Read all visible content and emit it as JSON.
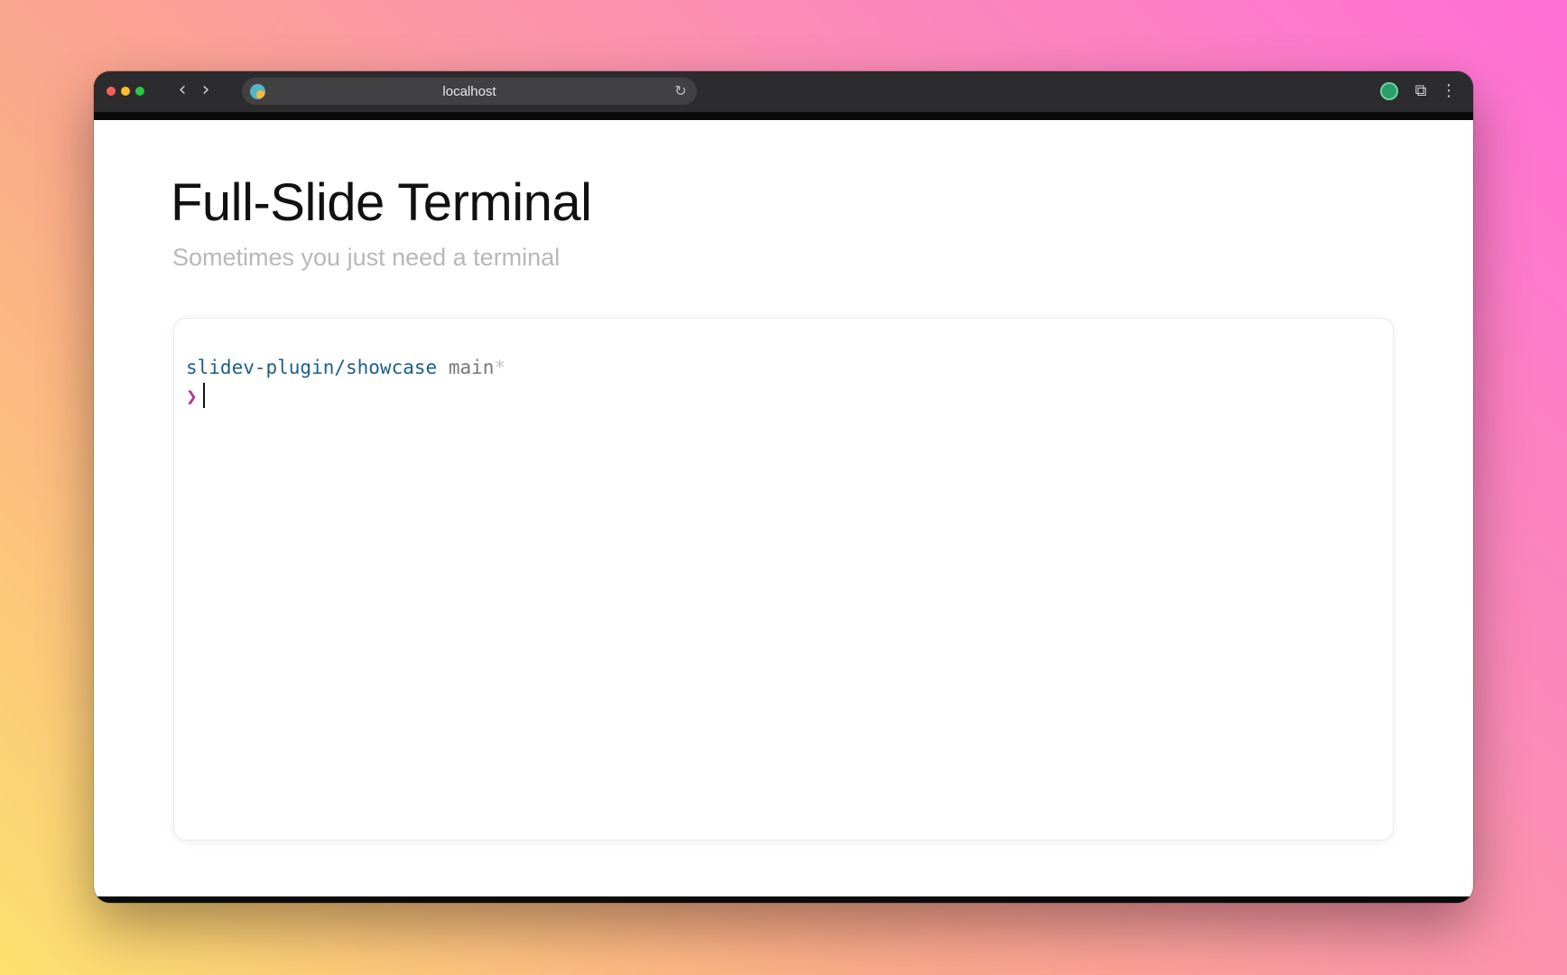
{
  "browser": {
    "url": "localhost",
    "icons": {
      "back": "chevron-left-icon",
      "forward": "chevron-right-icon",
      "reload": "reload-icon",
      "extensions": "puzzle-icon",
      "menu": "more-vertical-icon",
      "profile": "profile-icon"
    }
  },
  "slide": {
    "title": "Full-Slide Terminal",
    "subtitle": "Sometimes you just need a terminal"
  },
  "terminal": {
    "path": "slidev-plugin/showcase",
    "branch": "main",
    "dirty_marker": "*",
    "prompt_symbol": "❯",
    "input_value": ""
  },
  "colors": {
    "path": "#1d5f8a",
    "prompt": "#b7348f",
    "subtitle": "#b8b8b8"
  }
}
